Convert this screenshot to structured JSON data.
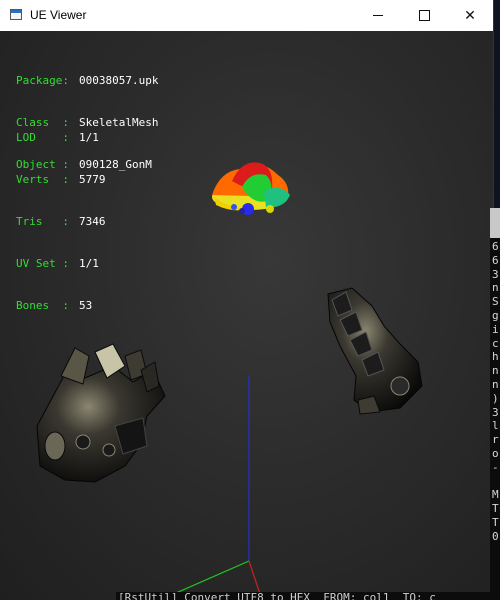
{
  "window": {
    "title": "UE Viewer",
    "minimize_label": "",
    "maximize_label": "",
    "close_label": "✕"
  },
  "info": {
    "package": {
      "key": "Package:",
      "value": "00038057.upk"
    },
    "class": {
      "key": "Class  :",
      "value": "SkeletalMesh"
    },
    "object": {
      "key": "Object :",
      "value": "090128_GonM"
    },
    "lod": {
      "key": "LOD    :",
      "value": "1/1"
    },
    "verts": {
      "key": "Verts  :",
      "value": "5779"
    },
    "tris": {
      "key": "Tris   :",
      "value": "7346"
    },
    "uvset": {
      "key": "UV Set :",
      "value": "1/1"
    },
    "bones": {
      "key": "Bones  :",
      "value": "53"
    }
  },
  "desktop": {
    "left_letter": "M"
  },
  "terminal": {
    "lines": "6\n6\n3\nn\nS\ng\ni\nc\nh\nn\nn\n)\n3\nl\nr\no\n-\n\nM\nT\nT\n0"
  },
  "status": {
    "text": "[RstUtil] Convert UTF8 to HEX  FROM: col1  TO: c"
  },
  "colors": {
    "label_green": "#33dd33",
    "value_white": "#ffffff",
    "axis_x": "#cc2222",
    "axis_y": "#22cc22",
    "axis_z": "#2233cc"
  }
}
